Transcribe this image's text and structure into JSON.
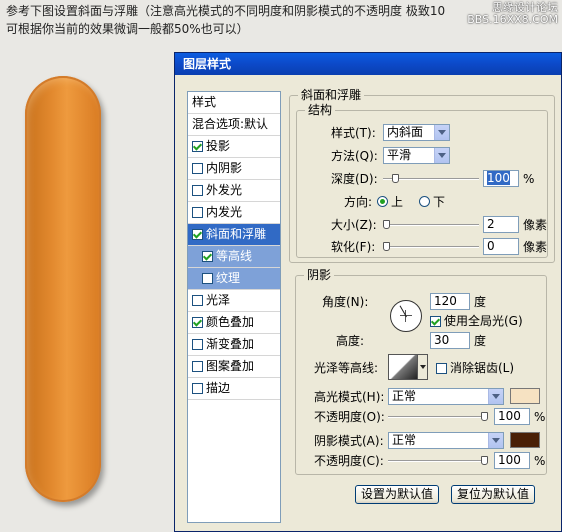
{
  "caption": {
    "line1": "参考下图设置斜面与浮雕（注意高光模式的不同明度和阴影模式的不透明度 极致10",
    "line2": "可根据你当前的效果微调一般都50%也可以）"
  },
  "watermark": {
    "line1": "思缘设计论坛",
    "line2": "BBS.16XX8.COM"
  },
  "colors": {
    "pill": "#e08a2e",
    "titlebar": "#0c49c8",
    "highlight_swatch": "#f6e2c2",
    "shadow_swatch": "#4a1f05"
  },
  "dialog": {
    "title": "图层样式"
  },
  "left_panel": {
    "header": "样式",
    "blend": "混合选项:默认",
    "items": [
      {
        "label": "投影",
        "checked": true
      },
      {
        "label": "内阴影",
        "checked": false
      },
      {
        "label": "外发光",
        "checked": false
      },
      {
        "label": "内发光",
        "checked": false
      },
      {
        "label": "斜面和浮雕",
        "checked": true
      },
      {
        "label": "等高线",
        "checked": true
      },
      {
        "label": "纹理",
        "checked": false
      },
      {
        "label": "光泽",
        "checked": false
      },
      {
        "label": "颜色叠加",
        "checked": true
      },
      {
        "label": "渐变叠加",
        "checked": false
      },
      {
        "label": "图案叠加",
        "checked": false
      },
      {
        "label": "描边",
        "checked": false
      }
    ]
  },
  "bevel": {
    "group_title": "斜面和浮雕",
    "structure_title": "结构",
    "style_label": "样式(T):",
    "style_value": "内斜面",
    "technique_label": "方法(Q):",
    "technique_value": "平滑",
    "depth_label": "深度(D):",
    "depth_value": "100",
    "depth_unit": "%",
    "depth_fraction": 0.1,
    "direction_label": "方向:",
    "direction_up": "上",
    "direction_down": "下",
    "size_label": "大小(Z):",
    "size_value": "2",
    "size_unit": "像素",
    "size_fraction": 0.0,
    "soften_label": "软化(F):",
    "soften_value": "0",
    "soften_unit": "像素",
    "soften_fraction": 0.0
  },
  "shading": {
    "title": "阴影",
    "angle_label": "角度(N):",
    "angle_value": "120",
    "angle_unit": "度",
    "global_light_label": "使用全局光(G)",
    "altitude_label": "高度:",
    "altitude_value": "30",
    "altitude_unit": "度",
    "gloss_label": "光泽等高线:",
    "antialias_label": "消除锯齿(L)",
    "highlight_mode_label": "高光模式(H):",
    "highlight_mode_value": "正常",
    "highlight_opacity_label": "不透明度(O):",
    "highlight_opacity_value": "100",
    "highlight_opacity_unit": "%",
    "highlight_opacity_fraction": 1.0,
    "shadow_mode_label": "阴影模式(A):",
    "shadow_mode_value": "正常",
    "shadow_opacity_label": "不透明度(C):",
    "shadow_opacity_value": "100",
    "shadow_opacity_unit": "%",
    "shadow_opacity_fraction": 1.0
  },
  "buttons": {
    "make_default": "设置为默认值",
    "reset_default": "复位为默认值"
  }
}
